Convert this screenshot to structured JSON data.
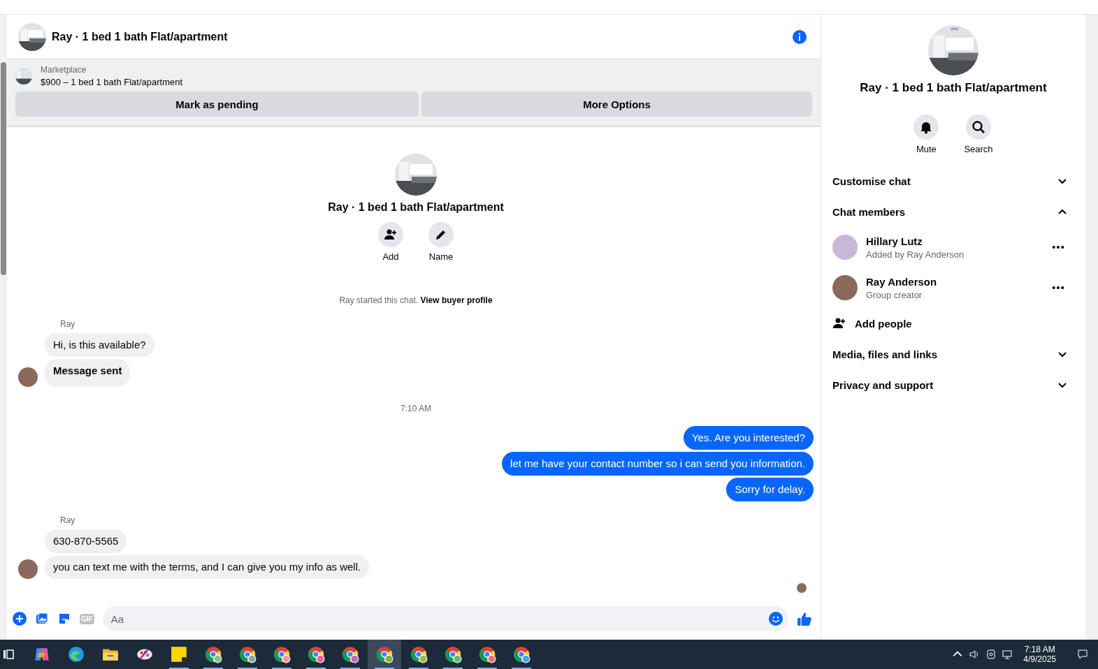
{
  "chat_header": {
    "title": "Ray · 1 bed 1 bath Flat/apartment"
  },
  "listing": {
    "source": "Marketplace",
    "title": "$900 – 1 bed 1 bath Flat/apartment",
    "buttons": [
      "Mark as pending",
      "More Options"
    ]
  },
  "intro": {
    "title": "Ray · 1 bed 1 bath Flat/apartment",
    "actions": [
      {
        "label": "Add",
        "kind": "add"
      },
      {
        "label": "Name",
        "kind": "edit"
      }
    ],
    "note": "Ray started this chat. **View buyer profile**"
  },
  "messages": [
    {
      "kind": "sender",
      "text": "Ray"
    },
    {
      "kind": "incoming",
      "text": "Hi, is this available?",
      "avatar": false
    },
    {
      "kind": "incoming",
      "text": "Message sent",
      "avatar": true,
      "bold": true
    },
    {
      "kind": "time",
      "text": "7:10 AM"
    },
    {
      "kind": "outgoing",
      "text": "Yes. Are you interested?"
    },
    {
      "kind": "outgoing",
      "text": "let me have your contact number so i can send you information."
    },
    {
      "kind": "outgoing",
      "text": "Sorry for delay."
    },
    {
      "kind": "sender",
      "text": "Ray"
    },
    {
      "kind": "incoming",
      "text": "630-870-5565",
      "avatar": false
    },
    {
      "kind": "incoming",
      "text": "you can text me with the terms, and I can give you my info as well.",
      "avatar": true
    }
  ],
  "composer": {
    "placeholder": "Aa",
    "gif_label": "GIF"
  },
  "details": {
    "title": "Ray · 1 bed 1 bath Flat/apartment",
    "actions": [
      {
        "label": "Mute",
        "kind": "bell"
      },
      {
        "label": "Search",
        "kind": "search"
      }
    ],
    "sections": [
      {
        "label": "Customise chat",
        "expanded": false
      },
      {
        "label": "Chat members",
        "expanded": true,
        "members": [
          {
            "name": "Hillary Lutz",
            "role": "Added by Ray Anderson"
          },
          {
            "name": "Ray Anderson",
            "role": "Group creator"
          }
        ],
        "add_label": "Add people"
      },
      {
        "label": "Media, files and links",
        "expanded": false
      },
      {
        "label": "Privacy and support",
        "expanded": false
      }
    ]
  },
  "taskbar": {
    "apps": [
      {
        "kind": "copilot",
        "running": false,
        "selected": false
      },
      {
        "kind": "edge",
        "running": false,
        "selected": false
      },
      {
        "kind": "folder",
        "running": false,
        "selected": false
      },
      {
        "kind": "paint",
        "running": false,
        "selected": false
      },
      {
        "kind": "notes",
        "running": true,
        "selected": false
      },
      {
        "kind": "chrome",
        "running": true,
        "selected": false
      },
      {
        "kind": "chrome",
        "running": true,
        "selected": false
      },
      {
        "kind": "chrome",
        "running": true,
        "selected": false
      },
      {
        "kind": "chrome",
        "running": true,
        "selected": false
      },
      {
        "kind": "chrome",
        "running": true,
        "selected": false
      },
      {
        "kind": "chrome",
        "running": true,
        "selected": true
      },
      {
        "kind": "chrome",
        "running": true,
        "selected": false
      },
      {
        "kind": "chrome",
        "running": true,
        "selected": false
      },
      {
        "kind": "chrome",
        "running": true,
        "selected": false
      },
      {
        "kind": "chrome",
        "running": true,
        "selected": false
      }
    ],
    "time": "7:18 AM",
    "date": "4/9/2025"
  }
}
